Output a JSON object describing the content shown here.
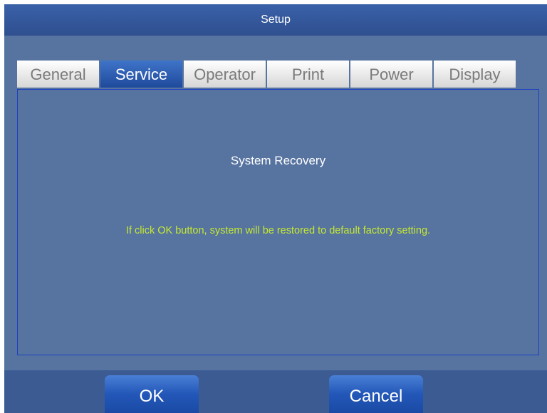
{
  "window": {
    "title": "Setup"
  },
  "tabs": [
    {
      "label": "General",
      "active": false
    },
    {
      "label": "Service",
      "active": true
    },
    {
      "label": "Operator",
      "active": false
    },
    {
      "label": "Print",
      "active": false
    },
    {
      "label": "Power",
      "active": false
    },
    {
      "label": "Display",
      "active": false
    }
  ],
  "panel": {
    "title": "System Recovery",
    "message": "If click OK button, system will be restored to default factory setting."
  },
  "footer": {
    "ok_label": "OK",
    "cancel_label": "Cancel"
  },
  "colors": {
    "title_bar": "#2f4f8f",
    "background": "#5774a1",
    "active_tab": "#2357b8",
    "panel_border": "#1c3fc2",
    "message_text": "#c5e82e"
  }
}
